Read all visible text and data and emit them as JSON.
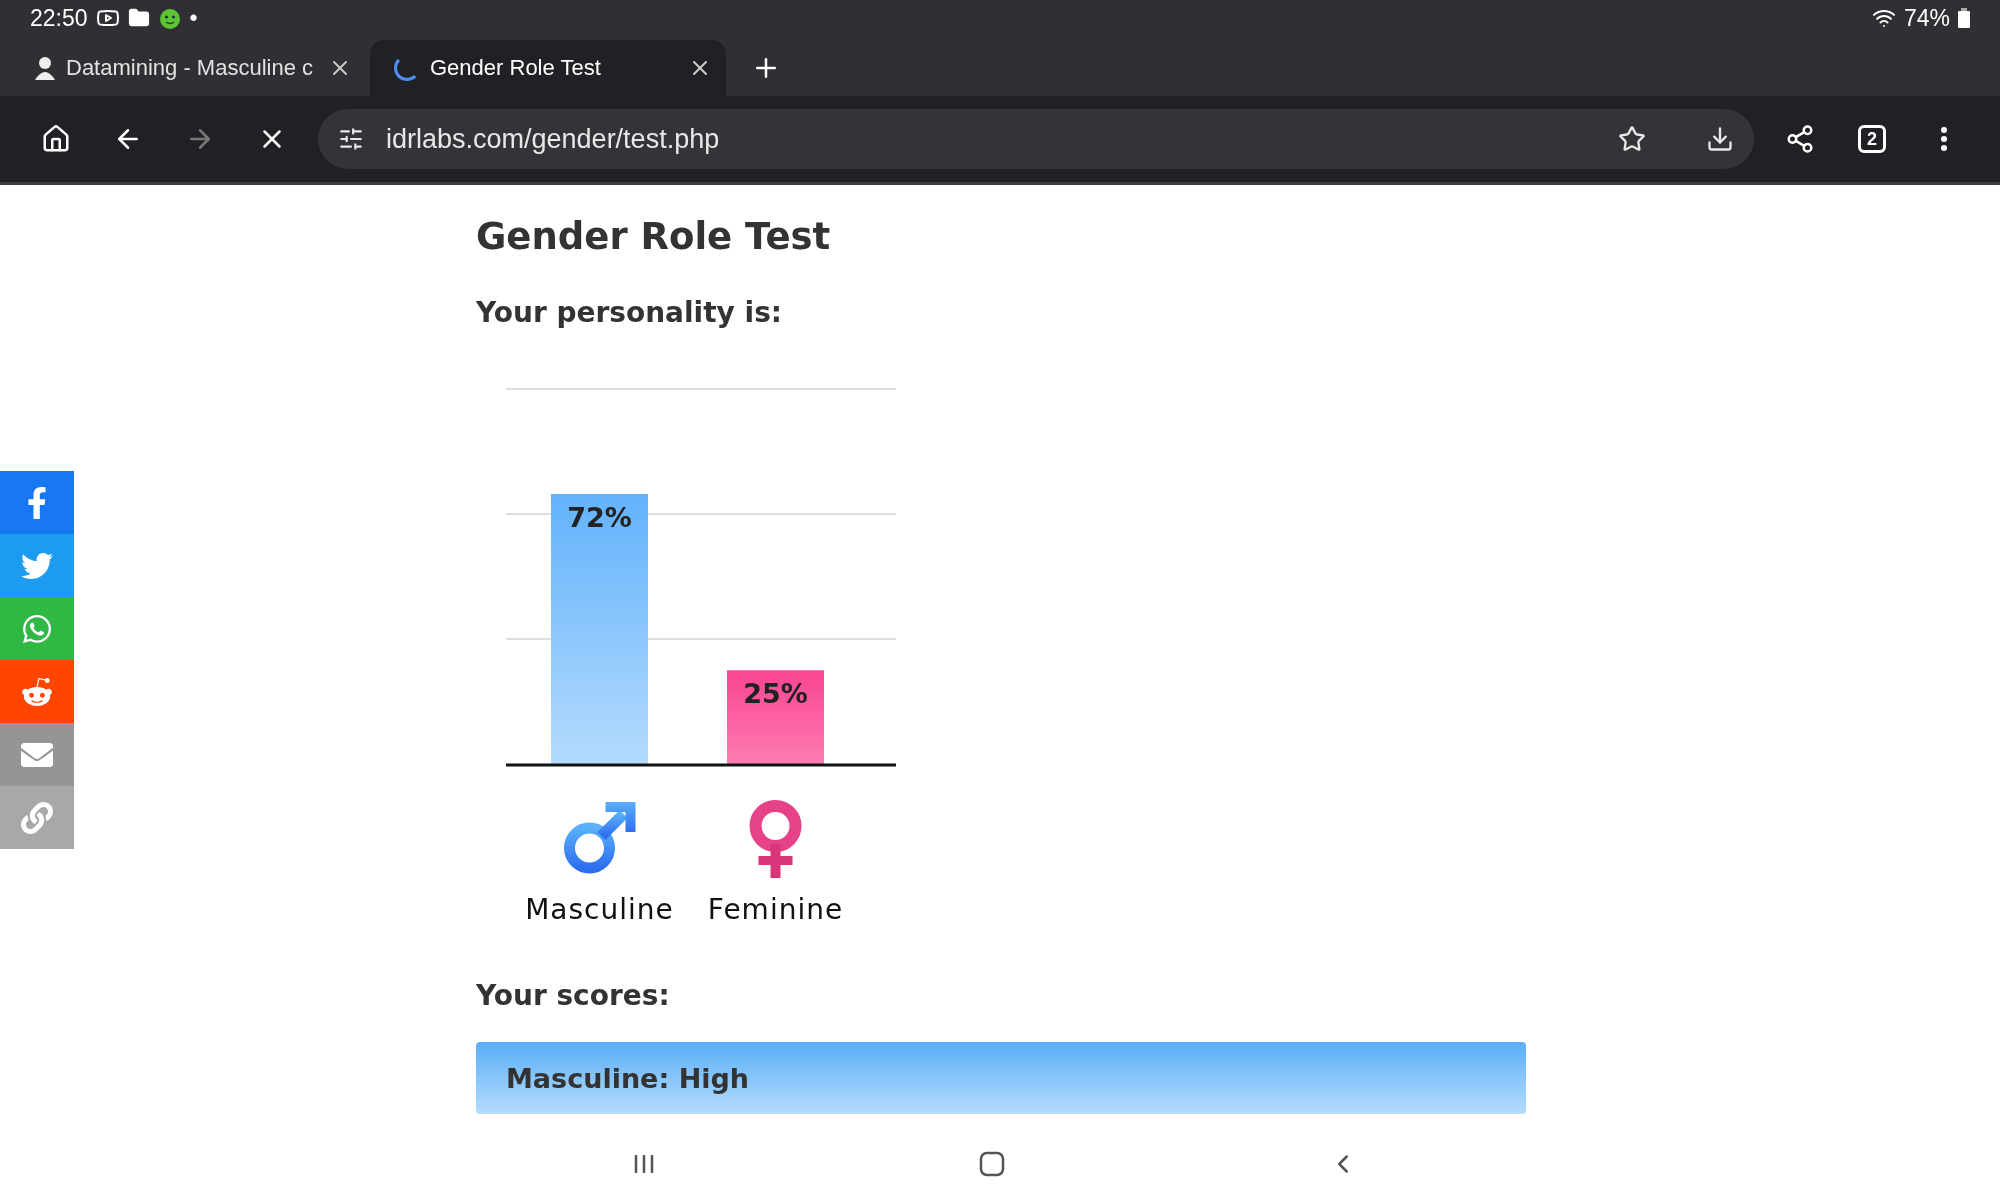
{
  "status_bar": {
    "time": "22:50",
    "dot": "•",
    "battery": "74%"
  },
  "tabs": [
    {
      "title": "Datamining - Masculine c",
      "selected": false,
      "loading": false
    },
    {
      "title": "Gender Role Test",
      "selected": true,
      "loading": true
    }
  ],
  "toolbar": {
    "url": "idrlabs.com/gender/test.php",
    "tab_count": "2",
    "forward_disabled": true
  },
  "share_buttons": [
    {
      "kind": "facebook",
      "color": "#1877f2"
    },
    {
      "kind": "twitter",
      "color": "#1d9bf0"
    },
    {
      "kind": "whatsapp",
      "color": "#2fb843"
    },
    {
      "kind": "reddit",
      "color": "#ff4500"
    },
    {
      "kind": "email",
      "color": "#959595"
    },
    {
      "kind": "link",
      "color": "#a8a8a8"
    }
  ],
  "page": {
    "title": "Gender Role Test",
    "subtitle": "Your personality is:",
    "chart_data": {
      "type": "bar",
      "categories": [
        "Masculine",
        "Feminine"
      ],
      "values": [
        72,
        25
      ],
      "value_labels": [
        "72%",
        "25%"
      ]
    },
    "scores_heading": "Your scores:",
    "scores": [
      {
        "label": "Masculine: High"
      }
    ]
  }
}
